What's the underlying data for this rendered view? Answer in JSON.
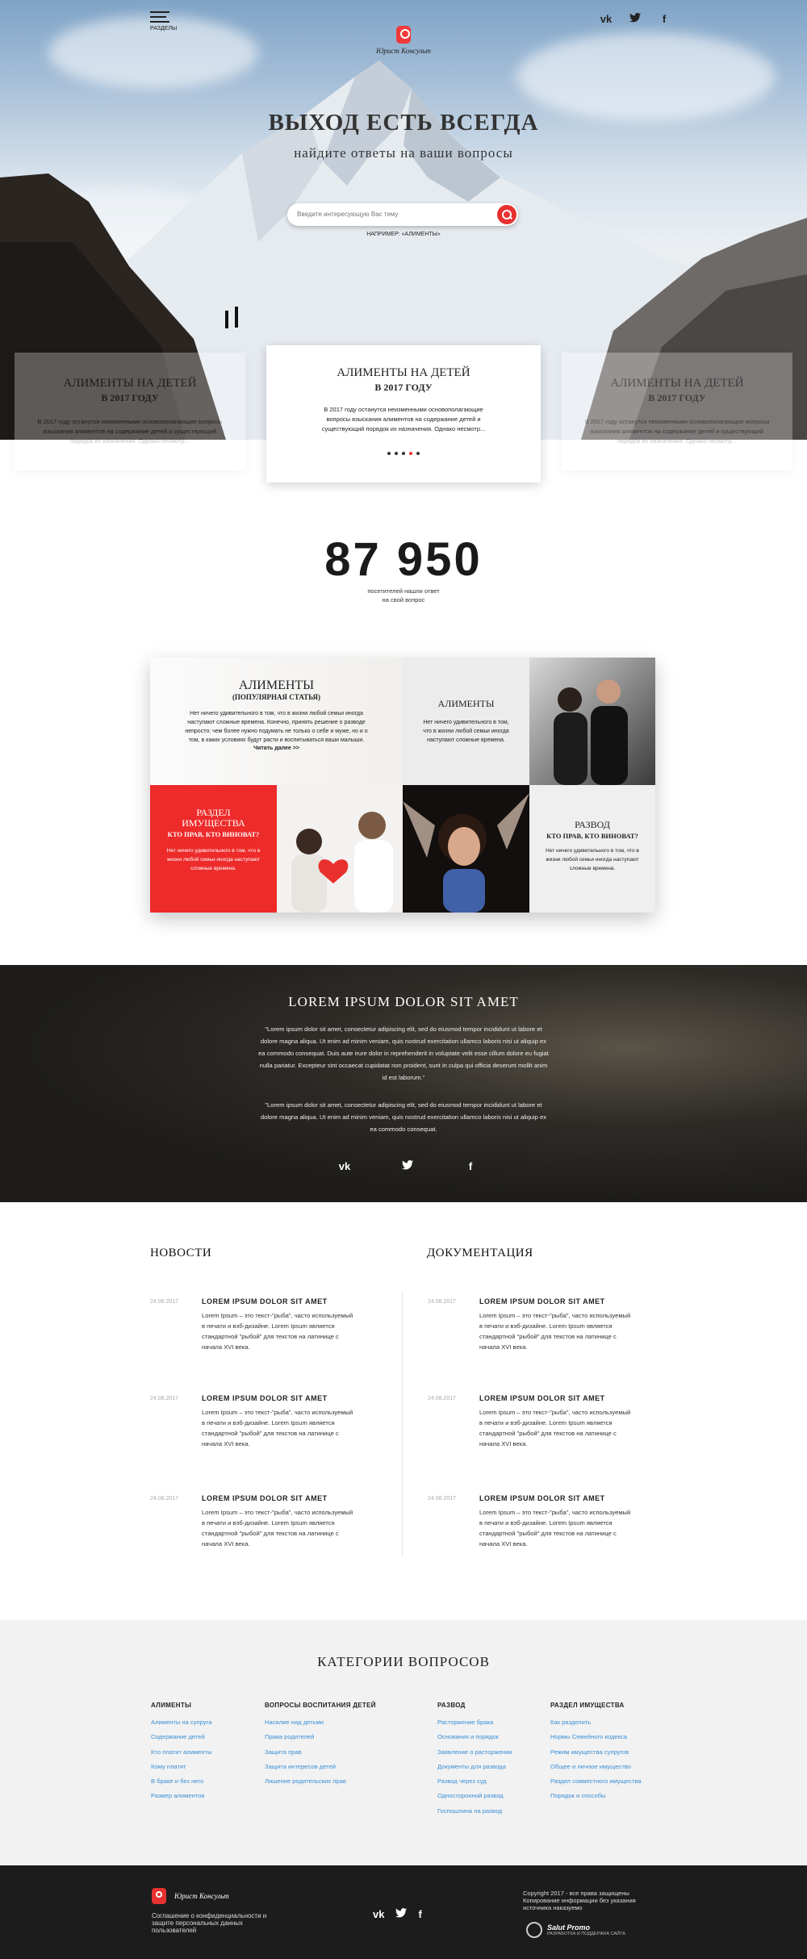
{
  "header": {
    "menu_label": "РАЗДЕЛЫ",
    "logo_text": "Юрист Консульт",
    "title": "ВЫХОД ЕСТЬ ВСЕГДА",
    "subtitle": "найдите ответы на ваши вопросы",
    "search": {
      "placeholder": "Введите интересующую Вас тему"
    },
    "example": "НАПРИМЕР: «АЛИМЕНТЫ»",
    "social": [
      "vk-icon",
      "twitter-icon",
      "facebook-icon"
    ]
  },
  "slider": {
    "cards": [
      {
        "title": "АЛИМЕНТЫ НА ДЕТЕЙ",
        "subtitle": "В 2017 ГОДУ",
        "text": "В 2017 году останутся неизменными основополагающие вопросы взыскания алиментов на содержание детей и существующий порядок их назначения. Однако несмотр..."
      },
      {
        "title": "АЛИМЕНТЫ НА ДЕТЕЙ",
        "subtitle": "В 2017 ГОДУ",
        "text": "В 2017 году останутся неизменными основополагающие вопросы взыскания алиментов на содержание детей и существующий порядок их назначения. Однако несмотр..."
      },
      {
        "title": "АЛИМЕНТЫ НА ДЕТЕЙ",
        "subtitle": "В 2017 ГОДУ",
        "text": "В 2017 году останутся неизменными основополагающие вопросы взыскания алиментов на содержание детей и существующий порядок их назначения. Однако несмотр..."
      }
    ],
    "dots_count": 5,
    "active_dot": 3
  },
  "counter": {
    "value": "87 950",
    "caption_line1": "посетителей нашли ответ",
    "caption_line2": "на свой вопрос"
  },
  "grid": {
    "featured": {
      "title": "АЛИМЕНТЫ",
      "subtitle": "(ПОПУЛЯРНАЯ СТАТЬЯ)",
      "text": "Нет ничего удивительного в том, что в жизни любой семьи иногда наступают сложные времена. Конечно, принять решение о разводе непросто: чем более нужно подумать не только о себе и муже, но и о том, в каких условиях будут расти и воспитываться ваши малыши.",
      "link": "Читать далее >>"
    },
    "alimony": {
      "title": "АЛИМЕНТЫ",
      "text": "Нет ничего удивительного в том, что в жизни любой семьи иногда наступают сложные времена."
    },
    "property": {
      "title_line1": "РАЗДЕЛ",
      "title_line2": "ИМУЩЕСТВА",
      "title_line3": "КТО ПРАВ, КТО ВИНОВАТ?",
      "text": "Нет ничего удивительного в том, что в жизни любой семьи иногда наступают сложные времена."
    },
    "divorce": {
      "title": "РАЗВОД",
      "title_line2": "КТО ПРАВ, КТО ВИНОВАТ?",
      "text": "Нет ничего удивительного в том, что в жизни любой семьи иногда наступают сложные времена."
    }
  },
  "banner": {
    "title": "LOREM IPSUM DOLOR SIT AMET",
    "p1": "\"Lorem ipsum dolor sit amet, consectetur adipiscing elit, sed do eiusmod tempor incididunt ut labore et dolore magna aliqua. Ut enim ad minim veniam, quis nostrud exercitation ullamco laboris nisi ut aliquip ex ea commodo consequat. Duis aute irure dolor in reprehenderit in voluptate velit esse cillum dolore eu fugiat nulla pariatur. Excepteur sint occaecat cupidatat non proident, sunt in culpa qui officia deserunt mollit anim id est laborum.\"",
    "p2": "\"Lorem ipsum dolor sit amet, consectetur adipiscing elit, sed do eiusmod tempor incididunt ut labore et dolore magna aliqua. Ut enim ad minim veniam, quis nostrud exercitation ullamco laboris nisi ut aliquip ex ea commodo consequat."
  },
  "news": {
    "heading": "НОВОСТИ",
    "items": [
      {
        "date": "24.08.2017",
        "title": "LOREM IPSUM DOLOR SIT AMET",
        "text": "Lorem Ipsum – это текст-\"рыба\", часто используемый в печати и вэб-дизайне. Lorem Ipsum является стандартной \"рыбой\" для текстов на латинице с начала XVI века."
      },
      {
        "date": "24.08.2017",
        "title": "LOREM IPSUM DOLOR SIT AMET",
        "text": "Lorem Ipsum – это текст-\"рыба\", часто используемый в печати и вэб-дизайне. Lorem Ipsum является стандартной \"рыбой\" для текстов на латинице с начала XVI века."
      },
      {
        "date": "24.08.2017",
        "title": "LOREM IPSUM DOLOR SIT AMET",
        "text": "Lorem Ipsum – это текст-\"рыба\", часто используемый в печати и вэб-дизайне. Lorem Ipsum является стандартной \"рыбой\" для текстов на латинице с начала XVI века."
      }
    ]
  },
  "docs": {
    "heading": "ДОКУМЕНТАЦИЯ",
    "items": [
      {
        "date": "24.08.2017",
        "title": "LOREM IPSUM DOLOR SIT AMET",
        "text": "Lorem Ipsum – это текст-\"рыба\", часто используемый в печати и вэб-дизайне. Lorem Ipsum является стандартной \"рыбой\" для текстов на латинице с начала XVI века."
      },
      {
        "date": "24.08.2017",
        "title": "LOREM IPSUM DOLOR SIT AMET",
        "text": "Lorem Ipsum – это текст-\"рыба\", часто используемый в печати и вэб-дизайне. Lorem Ipsum является стандартной \"рыбой\" для текстов на латинице с начала XVI века."
      },
      {
        "date": "24.08.2017",
        "title": "LOREM IPSUM DOLOR SIT AMET",
        "text": "Lorem Ipsum – это текст-\"рыба\", часто используемый в печати и вэб-дизайне. Lorem Ipsum является стандартной \"рыбой\" для текстов на латинице с начала XVI века."
      }
    ]
  },
  "categories": {
    "heading": "КАТЕГОРИИ ВОПРОСОВ",
    "columns": [
      {
        "title": "АЛИМЕНТЫ",
        "links": [
          "Алименты на супруга",
          "Содержание детей",
          "Кто платит алименты",
          "Кому платят",
          "В браке и без него",
          "Размер алиментов"
        ]
      },
      {
        "title": "ВОПРОСЫ ВОСПИТАНИЯ ДЕТЕЙ",
        "links": [
          "Насилие над детьми",
          "Права родителей",
          "Защита прав",
          "Защита интересов детей",
          "Лишение родительских прав"
        ]
      },
      {
        "title": "РАЗВОД",
        "links": [
          "Расторжение брака",
          "Основания и порядок",
          "Заявление о расторжении",
          "Документы для развода",
          "Развод через суд",
          "Односторонний развод",
          "Госпошлина на развод"
        ]
      },
      {
        "title": "РАЗДЕЛ ИМУЩЕСТВА",
        "links": [
          "Как разделить",
          "Нормы Семейного кодекса",
          "Режим имущества супругов",
          "Общее и личное имущество",
          "Раздел совместного имущества",
          "Порядок и способы"
        ]
      }
    ]
  },
  "footer": {
    "logo_text": "Юрист Консульт",
    "privacy": "Соглашение о конфиденциальности и защите персональных данных пользователей",
    "copyright": "Copyright 2017 - все права защищены Копирование информации без указания источника наказуемо",
    "dev_name": "Salut Promo",
    "dev_sub": "РАЗРАБОТКА И ПОДДЕРЖКА САЙТА"
  },
  "colors": {
    "accent": "#e8312f",
    "link": "#3b8fd6",
    "dark": "#1c1c1c",
    "light_bg": "#f2f2f2"
  }
}
